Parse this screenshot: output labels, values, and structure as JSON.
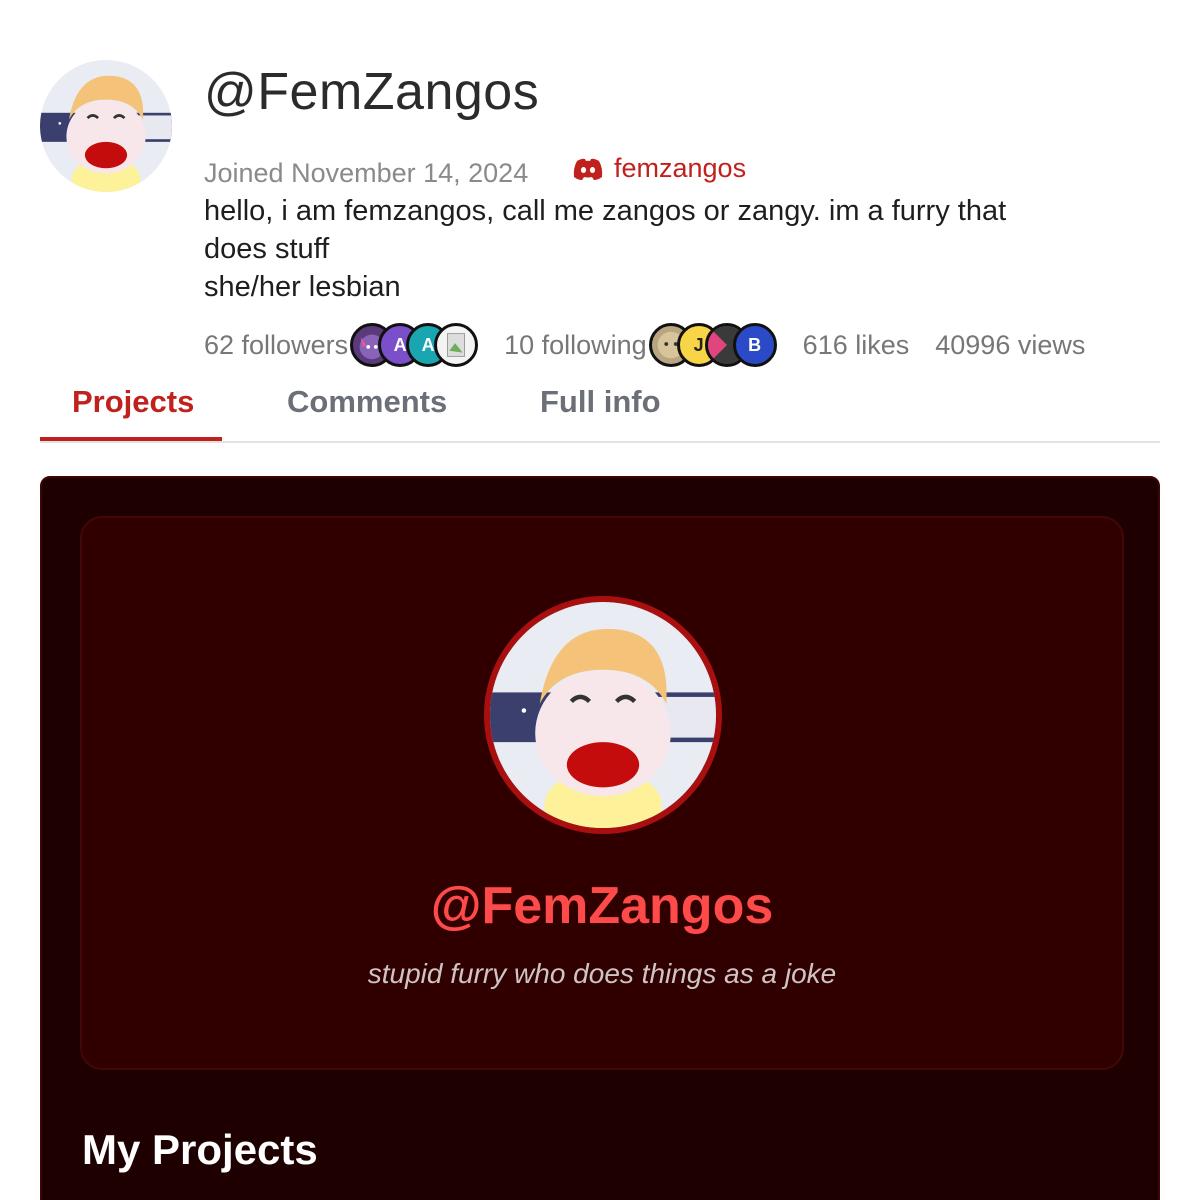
{
  "profile": {
    "username": "@FemZangos",
    "joined": "Joined November 14, 2024",
    "discord": "femzangos",
    "bio_lines": [
      "hello, i am femzangos, call me zangos or zangy. im a furry that",
      "does stuff",
      "she/her lesbian"
    ]
  },
  "stats": {
    "followers": "62 followers",
    "following": "10 following",
    "likes": "616 likes",
    "views": "40996 views",
    "follower_badges": [
      "A",
      "A"
    ],
    "following_badges": [
      "J",
      "B"
    ]
  },
  "tabs": [
    "Projects",
    "Comments",
    "Full info"
  ],
  "card": {
    "name": "@FemZangos",
    "tagline": "stupid furry who does things as a joke"
  },
  "section": {
    "title": "My Projects"
  },
  "colors": {
    "accent": "#c0211c",
    "panel_bg": "#1f0000",
    "card_bg": "#300000",
    "card_name": "#ff4a4a"
  },
  "icons": [
    "discord-icon",
    "avatar-image"
  ]
}
